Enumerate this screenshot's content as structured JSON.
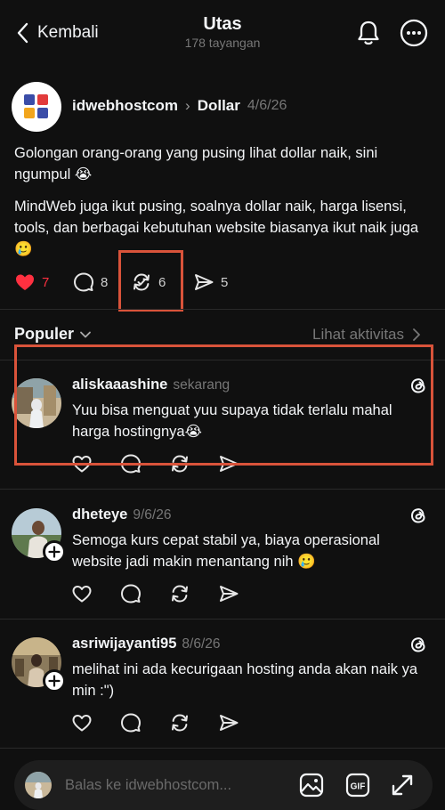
{
  "header": {
    "back_label": "Kembali",
    "title": "Utas",
    "views": "178 tayangan"
  },
  "post": {
    "author": "idwebhostcom",
    "topic": "Dollar",
    "date": "4/6/26",
    "paragraph1": "Golongan orang-orang yang pusing lihat dollar naik, sini ngumpul 😭",
    "paragraph2": "MindWeb juga ikut pusing, soalnya dollar naik, harga lisensi, tools, dan berbagai kebutuhan website biasanya ikut naik juga 🥲",
    "likes": "7",
    "comments": "8",
    "reposts": "6",
    "shares": "5",
    "like_color": "#ff3040"
  },
  "sort": {
    "label": "Populer",
    "activity_link": "Lihat aktivitas"
  },
  "replies": [
    {
      "username": "aliskaaashine",
      "time": "sekarang",
      "text": "Yuu bisa menguat yuu supaya tidak terlalu mahal harga hostingnya😭"
    },
    {
      "username": "dheteye",
      "time": "9/6/26",
      "text": "Semoga kurs cepat stabil ya, biaya operasional website jadi makin menantang nih 🥲"
    },
    {
      "username": "asriwijayanti95",
      "time": "8/6/26",
      "text": "melihat ini ada kecurigaan hosting anda akan naik ya min :\")"
    }
  ],
  "composer": {
    "placeholder": "Balas ke idwebhostcom..."
  },
  "colors": {
    "background": "#101010",
    "highlight": "#d9533a",
    "muted": "#777777"
  }
}
